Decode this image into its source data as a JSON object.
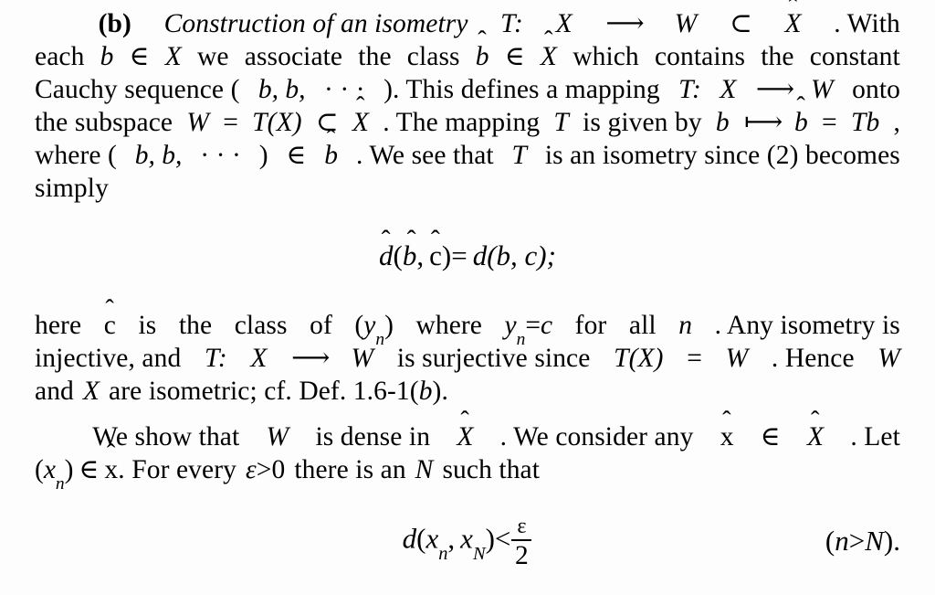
{
  "document": {
    "kind": "scanned-textbook-page",
    "subject": "functional analysis proof",
    "background_color": "#fdfdfd",
    "text_color": "#000000"
  },
  "paragraph1": {
    "label": "(b)",
    "heading": "Construction of an isometry",
    "line1_head": "T:",
    "line1_domain": "X",
    "line1_arrow": "⟶",
    "line1_codomain": "W",
    "line1_subset": "⊂",
    "line1_space": "X",
    "line1_tail": ". With",
    "line2": "each b ∈ X we associate the class b̂ ∈ X̂ which contains the constant",
    "line2_a": "each",
    "line2_b": "b",
    "line2_in": "∈",
    "line2_X": "X",
    "line2_c": "we",
    "line2_d": "associate",
    "line2_e": "the",
    "line2_f": "class",
    "line2_bhat": "b",
    "line2_in2": "∈",
    "line2_Xhat": "X",
    "line2_g": "which",
    "line2_h": "contains",
    "line2_i": "the",
    "line2_j": "constant",
    "line3_a": "Cauchy sequence (",
    "line3_b": "b, b,",
    "line3_dots": "· · ·",
    "line3_c": "). This defines a mapping",
    "line3_T": "T:",
    "line3_X": "X",
    "line3_arrow": "⟶",
    "line3_W": "W",
    "line3_onto": "onto",
    "line4_a": "the subspace",
    "line4_W": "W",
    "line4_eq": "=",
    "line4_TX": "T(X)",
    "line4_subset": "⊂",
    "line4_Xhat": "X",
    "line4_b": ". The mapping",
    "line4_T": "T",
    "line4_c": "is given by",
    "line4_bb": "b",
    "line4_mapsto": "⟼",
    "line4_bhat": "b",
    "line4_eq2": "=",
    "line4_Tb": "Tb",
    "line4_d": ",",
    "line5_a": "where (",
    "line5_b": "b, b,",
    "line5_dots": "· · ·",
    "line5_c": ")",
    "line5_in": "∈",
    "line5_bhat": "b",
    "line5_d": ". We see that",
    "line5_T": "T",
    "line5_e": "is an isometry since (2) becomes",
    "line6": "simply"
  },
  "equation1": {
    "lhs_d": "d",
    "lhs_open": "(",
    "lhs_b": "b",
    "lhs_comma": ",",
    "lhs_c": "c",
    "lhs_close": ")",
    "eq": "=",
    "rhs": "d(b, c);",
    "plain": "d̂(b̂, ĉ) = d(b, c);"
  },
  "paragraph2": {
    "line1_a": "here",
    "line1_chat": "c",
    "line1_b": "is",
    "line1_c": "the",
    "line1_d": "class",
    "line1_e": "of",
    "line1_yn_open": "(",
    "line1_y": "y",
    "line1_n": "n",
    "line1_yn_close": ")",
    "line1_f": "where",
    "line1_y2": "y",
    "line1_n2": "n",
    "line1_eq": "=",
    "line1_cc": "c",
    "line1_g": "for",
    "line1_h": "all",
    "line1_nn": "n",
    "line1_i": ". Any isometry is",
    "line2_a": "injective, and",
    "line2_T": "T:",
    "line2_X": "X",
    "line2_arrow": "⟶",
    "line2_W": "W",
    "line2_b": "is surjective since",
    "line2_TX": "T(X)",
    "line2_eq": "=",
    "line2_W2": "W",
    "line2_c": ". Hence",
    "line2_W3": "W",
    "line3_a": "and",
    "line3_X": "X",
    "line3_b": "are isometric; cf. Def. 1.6-1(",
    "line3_bb": "b",
    "line3_c": ")."
  },
  "paragraph3": {
    "line1_a": "We show that",
    "line1_W": "W",
    "line1_b": "is dense in",
    "line1_Xhat": "X",
    "line1_c": ". We consider any",
    "line1_xhat": "x",
    "line1_in": "∈",
    "line1_Xhat2": "X",
    "line1_d": ". Let",
    "line2_open": "(",
    "line2_x": "x",
    "line2_n": "n",
    "line2_close": ")",
    "line2_in": "∈",
    "line2_xhat": "x",
    "line2_a": ". For every",
    "line2_eps": "ε",
    "line2_gt": ">",
    "line2_zero": "0",
    "line2_b": "there is an",
    "line2_N": "N",
    "line2_c": "such that"
  },
  "equation2": {
    "lhs_d": "d",
    "lhs_open": "(",
    "lhs_x1": "x",
    "lhs_sub1": "n",
    "lhs_comma": ",",
    "lhs_x2": "x",
    "lhs_sub2": "N",
    "lhs_close": ")",
    "lt": "<",
    "frac_num": "ε",
    "frac_den": "2",
    "tag_open": "(",
    "tag_n": "n",
    "tag_gt": ">",
    "tag_N": "N",
    "tag_close": ").",
    "plain": "d(x_n, x_N) < ε/2      (n > N)."
  }
}
